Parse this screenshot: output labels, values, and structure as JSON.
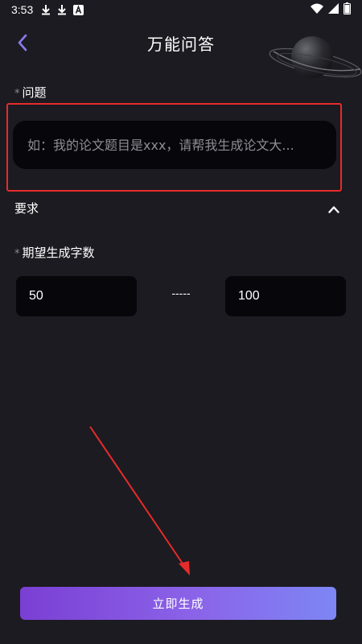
{
  "status_bar": {
    "time": "3:53",
    "left_icons": [
      "download-icon",
      "download-icon",
      "font-a-icon"
    ],
    "right_icons": [
      "wifi-icon",
      "signal-icon",
      "battery-icon"
    ]
  },
  "header": {
    "title": "万能问答",
    "back_icon": "chevron-left-icon",
    "back_color": "#8a7cf0"
  },
  "question": {
    "required_mark": "*",
    "label": "问题",
    "placeholder": "如：我的论文题目是xxx，请帮我生成论文大...",
    "highlight_color": "#e62b2b"
  },
  "requirements": {
    "label": "要求",
    "toggle_icon": "chevron-up-icon"
  },
  "word_count": {
    "required_mark": "*",
    "label": "期望生成字数",
    "min_value": "50",
    "separator": "-----",
    "max_value": "100"
  },
  "generate_button": {
    "label": "立即生成",
    "gradient_start": "#7a3fd4",
    "gradient_end": "#7d86f4"
  },
  "colors": {
    "background": "#1c1b21",
    "input_background": "#07060b",
    "annotation_arrow": "#e62b2b"
  }
}
